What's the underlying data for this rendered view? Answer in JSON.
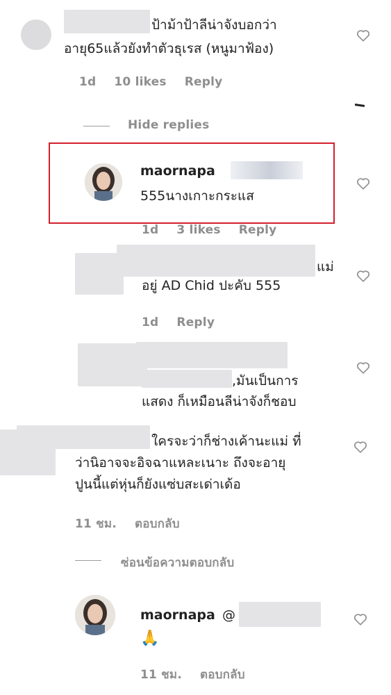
{
  "comments": [
    {
      "id": "c1",
      "lines": [
        "ป้าม้าป้าลีน่าจังบอกว่า",
        "อายุ65แล้วยังทำตัวธุเรส (หนูมาฟ้อง)"
      ],
      "meta": {
        "time": "1d",
        "likes": "10 likes",
        "reply": "Reply"
      },
      "hide_replies": "Hide replies"
    },
    {
      "id": "r1",
      "username": "maornapa",
      "lines": [
        "555นางเกาะกระแส"
      ],
      "meta": {
        "time": "1d",
        "likes": "3 likes",
        "reply": "Reply"
      }
    },
    {
      "id": "r2",
      "lines": [
        "แม่",
        "อยู่ AD Chid ปะคับ 555"
      ],
      "meta": {
        "time": "1d",
        "reply": "Reply"
      }
    },
    {
      "id": "r3",
      "lines": [
        ",มันเป็นการ",
        "แสดง ก็เหมือนลีน่าจังก็ชอบ"
      ]
    },
    {
      "id": "c2",
      "lines": [
        "ใครจะว่าก็ช่างเค้านะแม่ ที่",
        "ว่านิอาจจะอิจฉาแหละเนาะ ถึงจะอายุ",
        "ปูนนี้แต่หุ่นก็ยังแซ่บสะเด่าเด้อ"
      ],
      "meta": {
        "time": "11 ชม.",
        "reply": "ตอบกลับ"
      },
      "hide_replies": "ซ่อนข้อความตอบกลับ"
    },
    {
      "id": "r4",
      "username": "maornapa",
      "mention": "@",
      "emoji": "🙏",
      "meta": {
        "time": "11 ชม.",
        "reply": "ตอบกลับ"
      }
    }
  ],
  "icons": {
    "like": "heart-outline-icon"
  },
  "colors": {
    "highlight_border": "#d21f2b",
    "meta_text": "#8e8e8e"
  }
}
